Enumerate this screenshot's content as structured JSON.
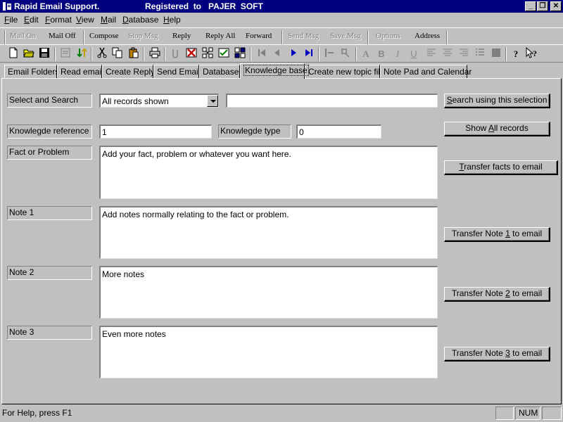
{
  "window": {
    "title": "Rapid Email Support.",
    "registration": "Registered  to   PAJER  SOFT",
    "controls": {
      "minimize": "_",
      "restore": "❐",
      "close": "✕"
    }
  },
  "menu": [
    {
      "label": "File",
      "hotkey": "F",
      "rest": "ile"
    },
    {
      "label": "Edit",
      "hotkey": "E",
      "rest": "dit"
    },
    {
      "label": "Format",
      "hotkey": "F",
      "rest": "ormat"
    },
    {
      "label": "View",
      "hotkey": "V",
      "rest": "iew"
    },
    {
      "label": "Mail",
      "hotkey": "M",
      "rest": "ail"
    },
    {
      "label": "Database",
      "hotkey": "D",
      "rest": "atabase"
    },
    {
      "label": "Help",
      "hotkey": "H",
      "rest": "elp"
    }
  ],
  "actions": {
    "mail_on": "Mail On",
    "mail_off": "Mail Off",
    "compose": "Compose",
    "stop_msg": "Stop Msg",
    "reply": "Reply",
    "reply_all": "Reply All",
    "forward": "Forward",
    "send_msg": "Send Msg",
    "save_msg": "Save Msg",
    "options": "Options",
    "address": "Address"
  },
  "tabs": {
    "email_folders": "Email Folders",
    "read_email": "Read email",
    "create_reply": "Create Reply",
    "send_email": "Send Email",
    "database": "Database",
    "knowledge_base": "Knowledge base",
    "create_topic": "Create new topic file",
    "notepad_calendar": "Note Pad and Calendar",
    "active": "Knowledge base"
  },
  "form": {
    "select_label": "Select and Search",
    "select_value": "All records shown",
    "search_text": "",
    "reference_label": "Knowlegde reference",
    "reference_value": "1",
    "type_label": "Knowlegde type",
    "type_value": "0",
    "fact_label": "Fact or Problem",
    "fact_value": "Add your fact, problem or whatever you want here.",
    "note1_label": "Note 1",
    "note1_value": "Add notes normally relating to the fact or problem.",
    "note2_label": "Note 2",
    "note2_value": "More notes",
    "note3_label": "Note 3",
    "note3_value": "Even more notes"
  },
  "buttons": {
    "search_pre": "",
    "search_key": "S",
    "search_post": "earch using this selection",
    "show_all_pre": "Show ",
    "show_all_key": "A",
    "show_all_post": "ll records",
    "transfer_facts_pre": "",
    "transfer_facts_key": "T",
    "transfer_facts_post": "ransfer facts to email",
    "transfer_note1_pre": "Transfer Note ",
    "transfer_note1_key": "1",
    "transfer_note1_post": " to email",
    "transfer_note2_pre": "Transfer Note ",
    "transfer_note2_key": "2",
    "transfer_note2_post": " to email",
    "transfer_note3_pre": "Transfer Note ",
    "transfer_note3_key": "3",
    "transfer_note3_post": " to email"
  },
  "status": {
    "help_text": "For Help, press F1",
    "num": "NUM"
  },
  "colors": {
    "titlebar": "#000080",
    "face": "#c0c0c0",
    "toolbar_blue": "#0000c0",
    "toolbar_red": "#c00000",
    "toolbar_green": "#008000"
  }
}
